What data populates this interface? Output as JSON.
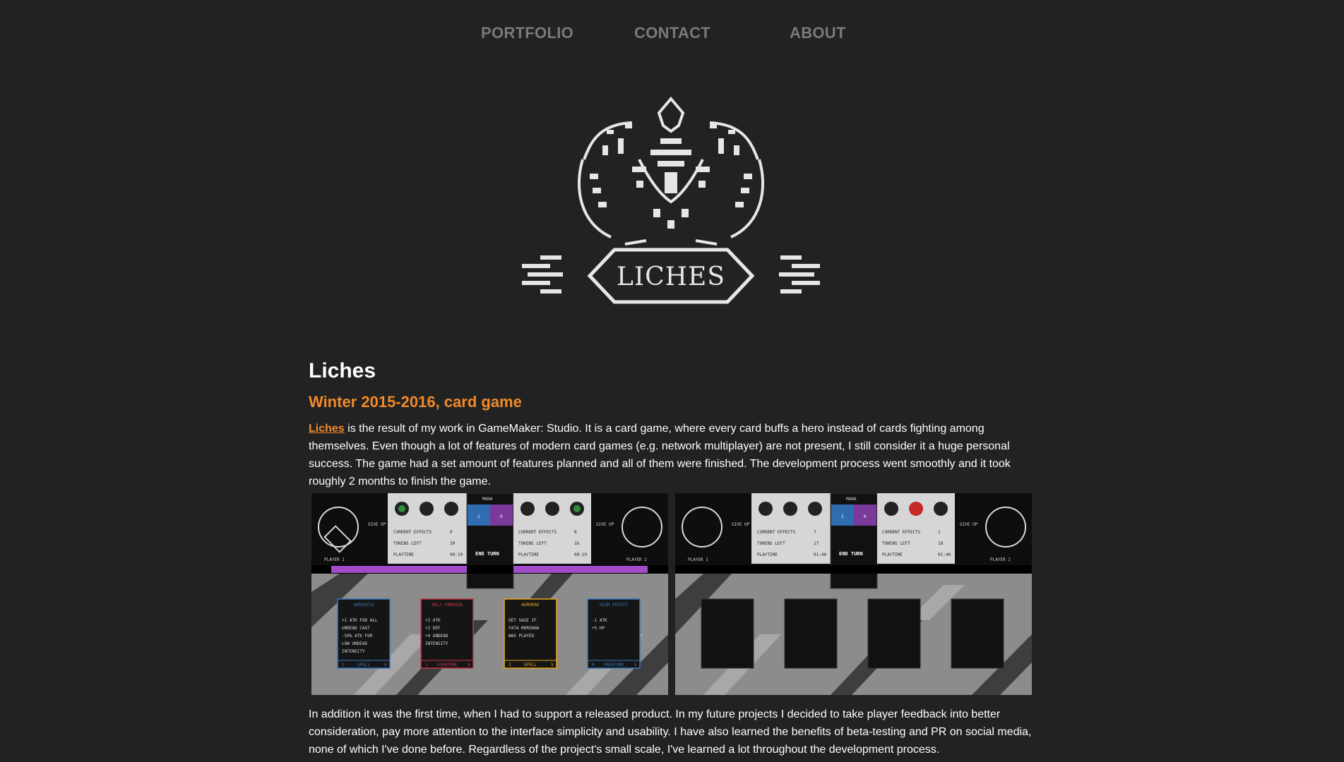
{
  "nav": {
    "portfolio": "PORTFOLIO",
    "contact": "CONTACT",
    "about": "ABOUT"
  },
  "logo": {
    "text": "LICHES",
    "icon": "liches-game-logo"
  },
  "project": {
    "title": "Liches",
    "subtitle": "Winter 2015-2016, card game",
    "link_text": "Liches",
    "intro_rest": " is the result of my work in GameMaker: Studio. It is a card game, where every card buffs a hero instead of cards fighting among themselves. Even though a lot of features of modern card games (e.g. network multiplayer) are not present, I still consider it a huge personal success. The game had a set amount of features planned and all of them were finished. The development process went smoothly and it took roughly 2 months to finish the game.",
    "outro": "In addition it was the first time, when I had to support a released product. In my future projects I decided to take player feedback into better consideration, pay more attention to the interface simplicity and usability. I have also learned the benefits of beta-testing and PR on social media, none of which I've done before. Regardless of the project's small scale, I've learned a lot throughout the development process."
  },
  "screenshot1": {
    "mana": "MANA",
    "give_up": "GIVE UP",
    "end_turn": "END TURN",
    "player1": "PLAYER 1",
    "player2": "PLAYER 2",
    "current_effects": "CURRENT EFFECTS",
    "tokens_left": "TOKENS LEFT",
    "playtime": "PLAYTIME",
    "p1_effects": "0",
    "p1_tokens": "20",
    "p1_time": "00:19",
    "p2_effects": "0",
    "p2_tokens": "16",
    "p2_time": "00:19",
    "mana_p1": "1",
    "mana_p2": "0",
    "cards": [
      {
        "name": "GARGOYLE",
        "line1": "+1 ATK FOR ALL",
        "line2": "UNDEAD CAST",
        "line3": "-50% ATK FOR",
        "line4": "LOW UNDEAD",
        "line5": "INTENSITY",
        "type": "SPELL",
        "cost": "1",
        "tier": "4",
        "color": "#3a79c4"
      },
      {
        "name": "HOLY PARAGON",
        "line1": "+2 ATK",
        "line2": "+2 DEF",
        "line3": "+4 UNDEAD",
        "line4": "INTENSITY",
        "line5": "",
        "type": "CREATURE",
        "cost": "1",
        "tier": "4",
        "color": "#c63a4a"
      },
      {
        "name": "AURORAE",
        "line1": "GET SAGE IF",
        "line2": "FATA MORGANA",
        "line3": "WAS PLAYED",
        "line4": "",
        "line5": "",
        "type": "SPELL",
        "cost": "2",
        "tier": "5",
        "color": "#e8a522"
      },
      {
        "name": "HIGH PRIEST",
        "line1": "-1 ATK",
        "line2": "+5 HP",
        "line3": "",
        "line4": "",
        "line5": "",
        "type": "CREATURE",
        "cost": "0",
        "tier": "5",
        "color": "#3a79c4"
      }
    ]
  },
  "screenshot2": {
    "mana": "MANA",
    "give_up": "GIVE UP",
    "end_turn": "END TURN",
    "player1": "PLAYER 1",
    "player2": "PLAYER 2",
    "current_effects": "CURRENT EFFECTS",
    "tokens_left": "TOKENS LEFT",
    "playtime": "PLAYTIME",
    "p1_effects": "7",
    "p1_tokens": "17",
    "p1_time": "01:40",
    "p2_effects": "1",
    "p2_tokens": "18",
    "p2_time": "01:40",
    "mana_p1": "1",
    "mana_p2": "0"
  },
  "colors": {
    "background": "#222222",
    "accent": "#f08a2c",
    "nav": "#7a7a7a",
    "mana_blue": "#2f6db0",
    "mana_purple": "#7a3a9a",
    "bar_purple": "#a24cc9"
  }
}
